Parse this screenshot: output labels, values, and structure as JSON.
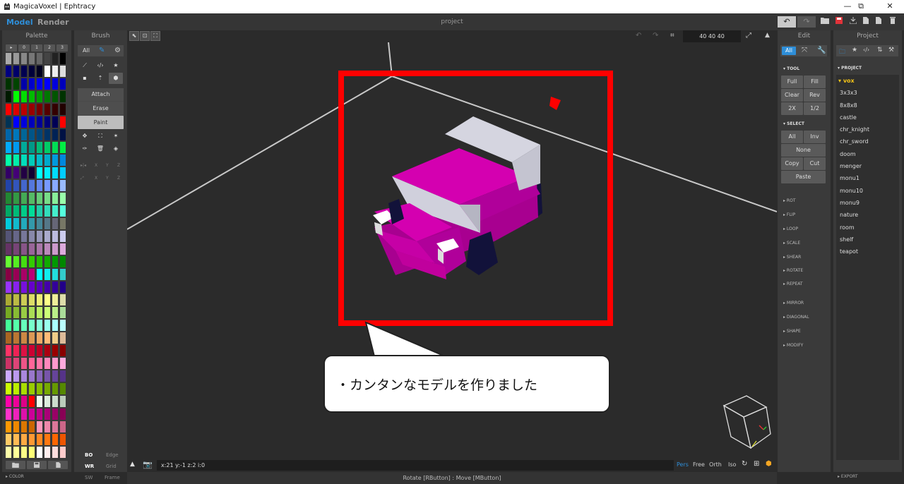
{
  "window": {
    "title": "MagicaVoxel | Ephtracy",
    "minimize": "—",
    "restore": "⧉",
    "close": "✕"
  },
  "menubar": {
    "mode_model": "Model",
    "mode_render": "Render",
    "project_name": "project"
  },
  "palette": {
    "title": "Palette",
    "tabs": [
      "▸",
      "0",
      "1",
      "2",
      "3"
    ],
    "footer": "COLOR"
  },
  "brush": {
    "title": "Brush",
    "tabs": {
      "all": "All"
    },
    "modes": [
      "Attach",
      "Erase",
      "Paint"
    ],
    "axes1": [
      "X",
      "Y",
      "Z"
    ],
    "axes2": [
      "X",
      "Y",
      "Z"
    ],
    "bottom": {
      "bo": "BO",
      "edge": "Edge",
      "wr": "WR",
      "grid": "Grid",
      "sw": "SW",
      "frame": "Frame"
    }
  },
  "viewport_top": {
    "size": "40  40  40"
  },
  "viewport_bottom": {
    "coords": "x:21   y:-1   z:2     i:0",
    "views": [
      "Pers",
      "Free",
      "Orth",
      "Iso"
    ]
  },
  "edit": {
    "title": "Edit",
    "tabs": {
      "all": "All"
    },
    "tool_label": "TOOL",
    "tool_buttons": [
      "Full",
      "Fill",
      "Clear",
      "Rev",
      "2X",
      "1/2"
    ],
    "select_label": "SELECT",
    "select_buttons": {
      "all": "All",
      "inv": "Inv",
      "none": "None",
      "copy": "Copy",
      "cut": "Cut",
      "paste": "Paste"
    },
    "sections": [
      "ROT",
      "FLIP",
      "LOOP",
      "SCALE",
      "SHEAR",
      "ROTATE",
      "REPEAT",
      "MIRROR",
      "DIAGONAL",
      "SHAPE",
      "MODIFY"
    ]
  },
  "project": {
    "title": "Project",
    "section": "PROJECT",
    "items": [
      "vox",
      "3x3x3",
      "8x8x8",
      "castle",
      "chr_knight",
      "chr_sword",
      "doom",
      "menger",
      "monu1",
      "monu10",
      "monu9",
      "nature",
      "room",
      "shelf",
      "teapot"
    ],
    "footer": "EXPORT"
  },
  "status": "Rotate [RButton] : Move [MButton]",
  "annotation": {
    "text": "・カンタンなモデルを作りました"
  },
  "colors": {
    "accent": "#2e8ed8",
    "highlight": "#ff0000",
    "voxel_magenta": "#d400b0",
    "voxel_gray": "#d5d5e0"
  }
}
